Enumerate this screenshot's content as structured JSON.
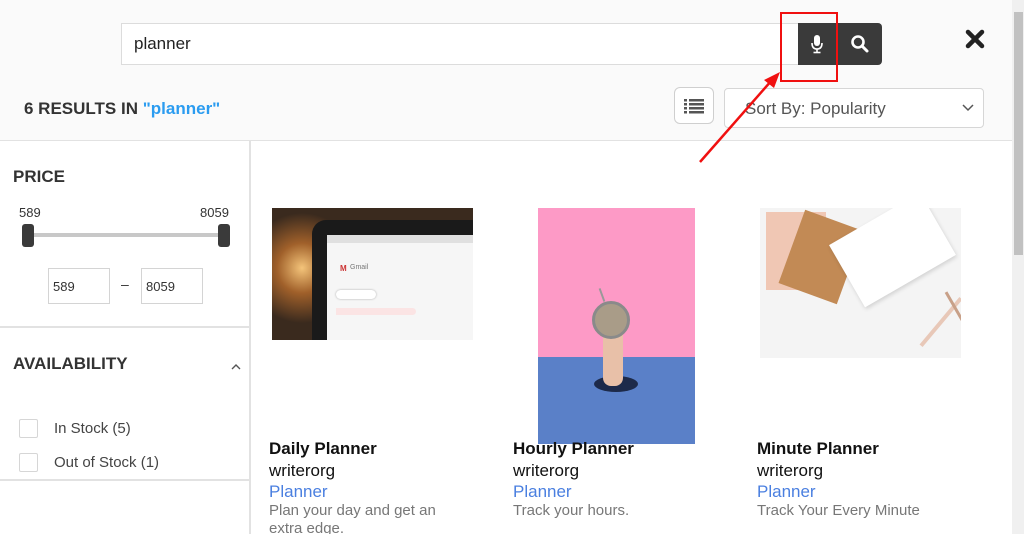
{
  "search": {
    "value": "planner",
    "mic_icon": "microphone-icon",
    "search_icon": "search-icon",
    "close_icon": "close-icon"
  },
  "results": {
    "count_text": "6 RESULTS IN",
    "query_text": "\"planner\""
  },
  "toolbar": {
    "view_icon": "list-view-icon",
    "sort_label": "Sort By: Popularity"
  },
  "filters": {
    "price": {
      "title": "PRICE",
      "min_label": "589",
      "max_label": "8059",
      "min_value": "589",
      "max_value": "8059",
      "separator": "–",
      "range_selected_fraction": [
        0,
        1
      ]
    },
    "availability": {
      "title": "AVAILABILITY",
      "options": [
        {
          "label": "In Stock (5)",
          "checked": false
        },
        {
          "label": "Out of Stock (1)",
          "checked": false
        }
      ]
    }
  },
  "products": [
    {
      "name": "Daily Planner",
      "vendor": "writerorg",
      "category": "Planner",
      "description": "Plan your day and get an extra edge.",
      "image": "laptop-gmail-photo"
    },
    {
      "name": "Hourly Planner",
      "vendor": "writerorg",
      "category": "Planner",
      "description": "Track your hours.",
      "image": "hand-alarm-clock-photo"
    },
    {
      "name": "Minute Planner",
      "vendor": "writerorg",
      "category": "Planner",
      "description": "Track Your Every Minute",
      "image": "notebooks-pencils-photo"
    }
  ],
  "colors": {
    "accent_query": "#2b9cf0",
    "category_link": "#4a7fe0",
    "button_dark": "#3a3a3a",
    "annotation": "#f01010"
  }
}
